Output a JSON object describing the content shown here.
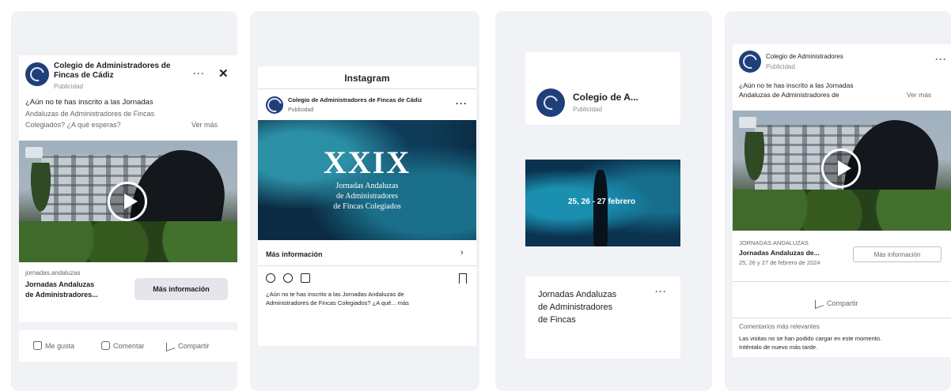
{
  "ads": {
    "facebook_feed": {
      "page_name": "Colegio de Administradores de Fincas de Cádiz",
      "sponsored": "Publicidad",
      "body_lines": [
        "¿Aún no te has inscrito a las Jornadas",
        "Andaluzas de Administradores de Fincas",
        "Colegiados? ¿A qué esperas?"
      ],
      "see_more": "Ver más",
      "link_domain": "jornadas.andaluzas",
      "headline_lines": [
        "Jornadas Andaluzas",
        "de Administradores..."
      ],
      "cta": "Más información",
      "actions": {
        "like": "Me gusta",
        "comment": "Comentar",
        "share": "Compartir"
      }
    },
    "instagram_feed": {
      "app_title": "Instagram",
      "account": "Colegio de Administradores de Fincas de Cádiz",
      "sponsored": "Publicidad",
      "visual_title": "XXIX",
      "visual_lines": [
        "Jornadas Andaluzas",
        "de Administradores",
        "de Fincas Colegiados"
      ],
      "cta": "Más información",
      "caption_lines": [
        "¿Aún no te has inscrito a las Jornadas Andaluzas de",
        "Administradores de Fincas Colegiados? ¿A qué... más"
      ]
    },
    "instagram_stories": {
      "page_name": "Colegio de A...",
      "sponsored": "Publicidad",
      "visual_text": "25, 26 - 27 febrero",
      "headline_lines": [
        "Jornadas Andaluzas",
        "de Administradores",
        "de Fincas"
      ]
    },
    "facebook_video": {
      "page_name": "Colegio de Administradores",
      "sponsored": "Publicidad",
      "body_line_1": "¿Aún no te has inscrito a las Jornadas",
      "body_line_2": "Andaluzas de Administradores de",
      "see_more": "Ver más",
      "link_domain": "JORNADAS.ANDALUZAS",
      "headline": "Jornadas Andaluzas de...",
      "description": "25, 26 y 27 de febrero de 2024",
      "cta": "Más información",
      "share": "Compartir",
      "comments_header": "Comentarios más relevantes",
      "comment_lines": [
        "Las visitas no se han podido cargar en este momento.",
        "Inténtalo de nuevo más tarde."
      ]
    }
  },
  "colors": {
    "panel_bg": "#f0f2f5",
    "fb_button": "#e4e6eb",
    "avatar": "#1f3f7a"
  }
}
